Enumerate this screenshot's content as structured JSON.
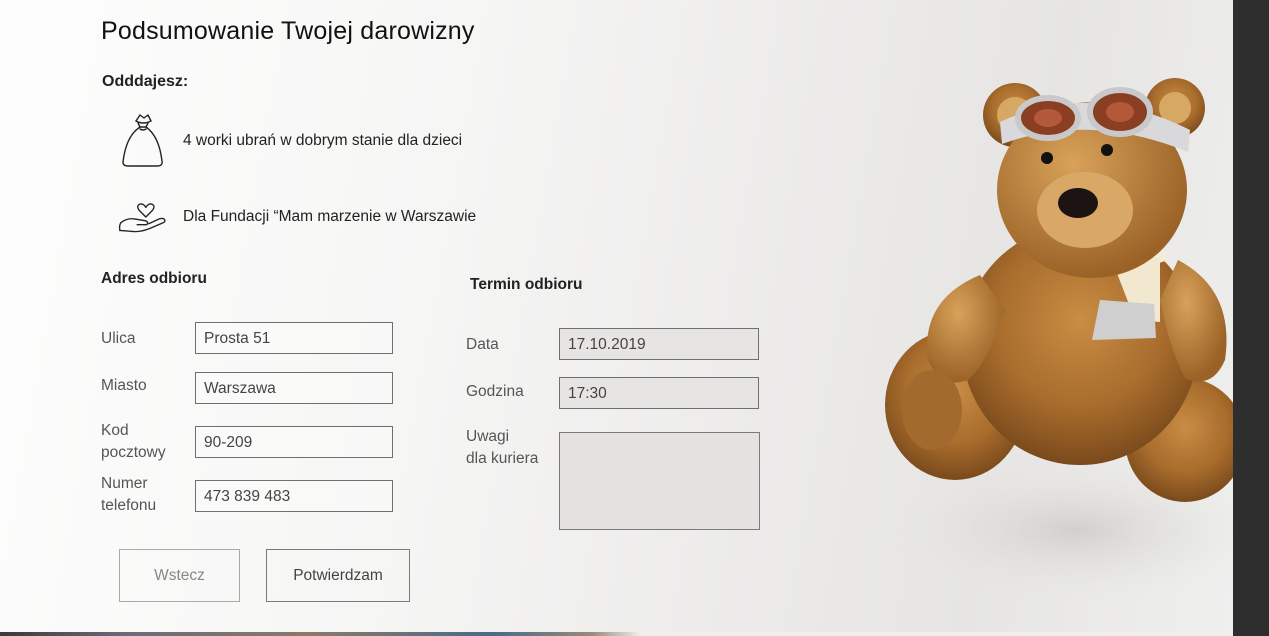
{
  "summary": {
    "title": "Podsumowanie Twojej darowizny",
    "giving_label": "Odddajesz:",
    "items": [
      {
        "icon": "bag-icon",
        "text": "4 worki ubrań w dobrym stanie dla dzieci"
      },
      {
        "icon": "heart-hand-icon",
        "text": "Dla Fundacji “Mam marzenie w Warszawie"
      }
    ]
  },
  "address": {
    "heading": "Adres odbioru",
    "fields": [
      {
        "label": "Ulica",
        "value": "Prosta 51"
      },
      {
        "label": "Miasto",
        "value": "Warszawa"
      },
      {
        "label_line1": "Kod",
        "label_line2": "pocztowy",
        "value": "90-209"
      },
      {
        "label_line1": "Numer",
        "label_line2": "telefonu",
        "value": "473 839 483"
      }
    ]
  },
  "pickup": {
    "heading": "Termin odbioru",
    "fields": [
      {
        "label": "Data",
        "value": "17.10.2019"
      },
      {
        "label": "Godzina",
        "value": "17:30"
      },
      {
        "label_line1": "Uwagi",
        "label_line2": "dla kuriera",
        "value": ""
      }
    ]
  },
  "buttons": {
    "back": "Wstecz",
    "confirm": "Potwierdzam"
  },
  "colors": {
    "page_bg": "#f6f6f5",
    "input_border": "#6f6f6f",
    "input_fill_gray": "#e7e5e3",
    "sidebar_dark": "#2e2e2e",
    "bear_fur": "#b57a35"
  }
}
